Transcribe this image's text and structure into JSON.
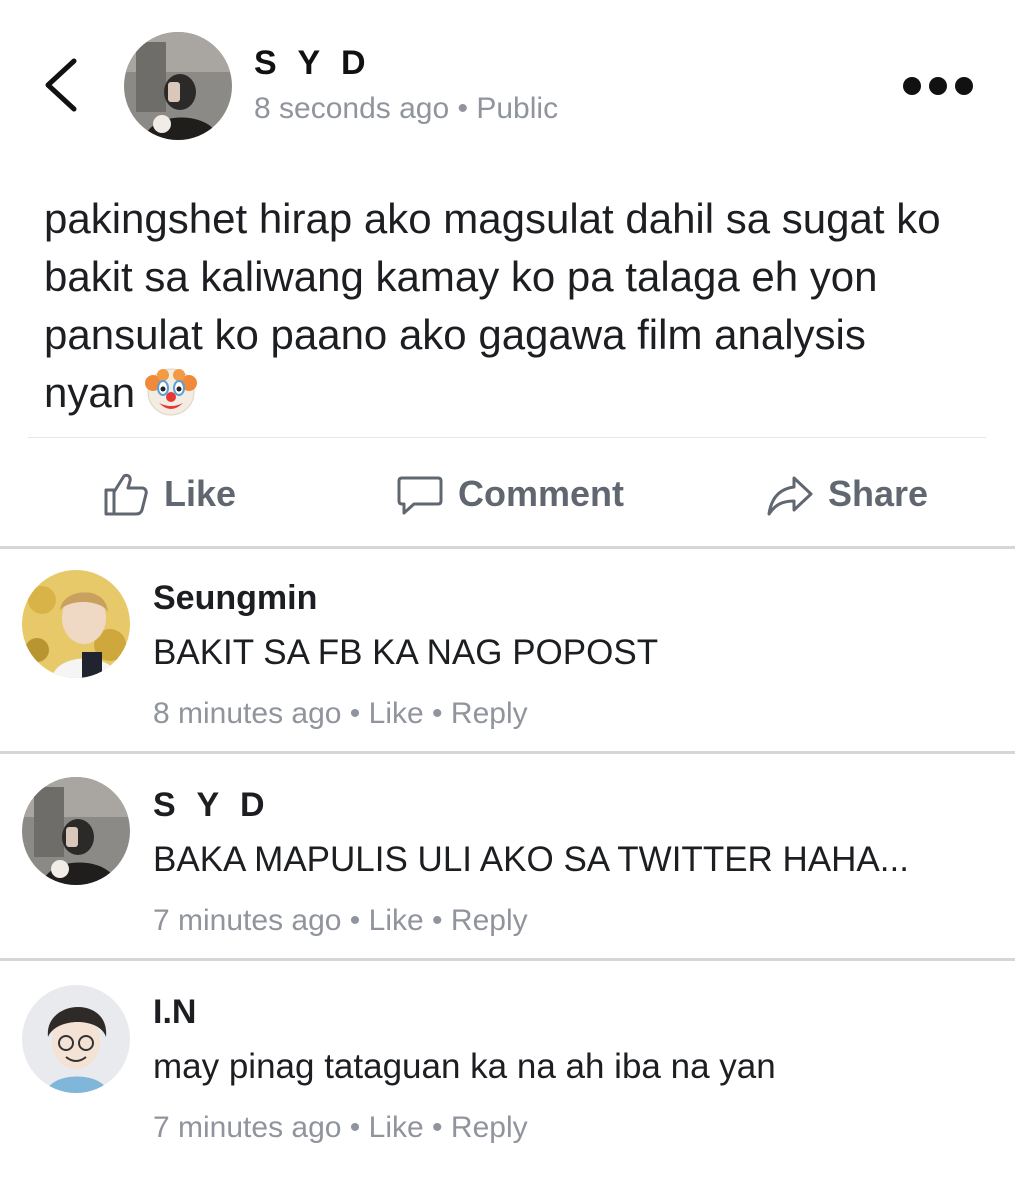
{
  "post": {
    "author": "S Y D",
    "time": "8 seconds ago",
    "separator": "•",
    "visibility": "Public",
    "text": "pakingshet hirap ako magsulat dahil sa sugat ko bakit sa kaliwang kamay ko pa talaga eh yon pansulat ko paano ako gagawa film analysis nyan",
    "emoji": "clown-face"
  },
  "actions": {
    "like": "Like",
    "comment": "Comment",
    "share": "Share"
  },
  "comments": [
    {
      "name": "Seungmin",
      "text": "BAKIT SA FB KA NAG POPOST",
      "time": "8 minutes ago",
      "like": "Like",
      "reply": "Reply"
    },
    {
      "name": "S Y D",
      "text": "BAKA MAPULIS ULI AKO SA TWITTER HAHA...",
      "time": "7 minutes ago",
      "like": "Like",
      "reply": "Reply"
    },
    {
      "name": "I.N",
      "text": "may pinag tataguan ka na ah iba na yan",
      "time": "7 minutes ago",
      "like": "Like",
      "reply": "Reply"
    }
  ],
  "colors": {
    "meta_gray": "#90949c",
    "action_gray": "#616770",
    "divider": "#d4d6da"
  }
}
